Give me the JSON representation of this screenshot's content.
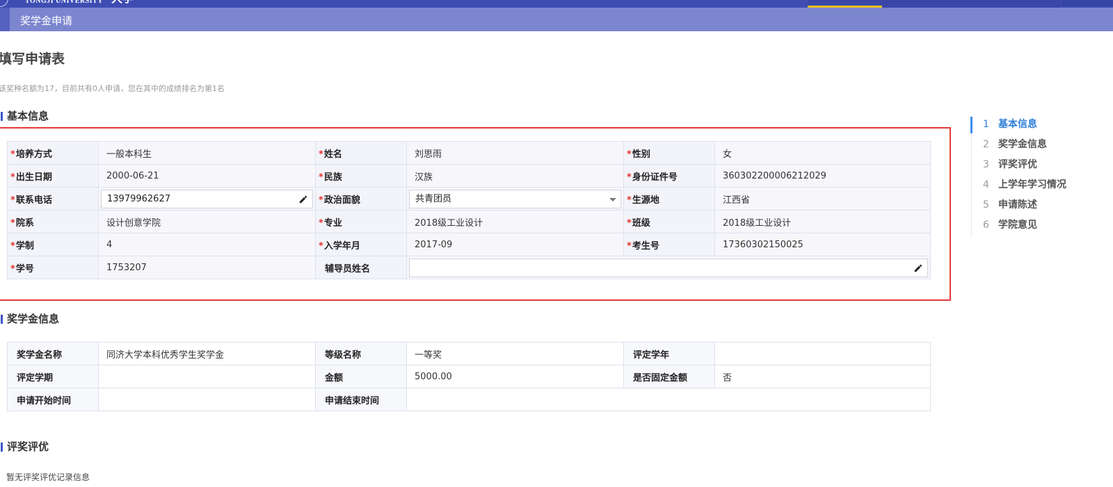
{
  "header": {
    "university_en": "TONGJI UNIVERSITY",
    "university_cn": "大学",
    "subbar_title": "奖学金申请"
  },
  "page": {
    "title": "填写申请表",
    "notice": "该奖种名额为17，目前共有0人申请，您在其中的成绩排名为第1名"
  },
  "sections": {
    "basic": "基本信息",
    "scholarship": "奖学金信息",
    "evaluation": "评奖评优"
  },
  "basic_info": {
    "rows": [
      [
        {
          "label": "培养方式",
          "value": "一般本科生",
          "required": true
        },
        {
          "label": "姓名",
          "value": "刘思雨",
          "required": true
        },
        {
          "label": "性别",
          "value": "女",
          "required": true
        }
      ],
      [
        {
          "label": "出生日期",
          "value": "2000-06-21",
          "required": true
        },
        {
          "label": "民族",
          "value": "汉族",
          "required": true
        },
        {
          "label": "身份证件号",
          "value": "360302200006212029",
          "required": true
        }
      ],
      [
        {
          "label": "联系电话",
          "value": "13979962627",
          "required": true,
          "input": "text"
        },
        {
          "label": "政治面貌",
          "value": "共青团员",
          "required": true,
          "input": "select"
        },
        {
          "label": "生源地",
          "value": "江西省",
          "required": true
        }
      ],
      [
        {
          "label": "院系",
          "value": "设计创意学院",
          "required": true
        },
        {
          "label": "专业",
          "value": "2018级工业设计",
          "required": true
        },
        {
          "label": "班级",
          "value": "2018级工业设计",
          "required": true
        }
      ],
      [
        {
          "label": "学制",
          "value": "4",
          "required": true
        },
        {
          "label": "入学年月",
          "value": "2017-09",
          "required": true
        },
        {
          "label": "考生号",
          "value": "17360302150025",
          "required": true
        }
      ],
      [
        {
          "label": "学号",
          "value": "1753207",
          "required": true
        },
        {
          "label": "辅导员姓名",
          "value": "",
          "required": false,
          "input": "text"
        }
      ]
    ]
  },
  "scholarship_info": {
    "rows": [
      [
        {
          "label": "奖学金名称",
          "value": "同济大学本科优秀学生奖学金"
        },
        {
          "label": "等级名称",
          "value": "一等奖"
        },
        {
          "label": "评定学年",
          "value": ""
        }
      ],
      [
        {
          "label": "评定学期",
          "value": ""
        },
        {
          "label": "金额",
          "value": "5000.00"
        },
        {
          "label": "是否固定金额",
          "value": "否"
        }
      ],
      [
        {
          "label": "申请开始时间",
          "value": ""
        },
        {
          "label": "申请结束时间",
          "value": ""
        }
      ]
    ]
  },
  "evaluation": {
    "empty_message": "暂无评奖评优记录信息"
  },
  "side_nav": {
    "items": [
      {
        "num": "1",
        "label": "基本信息",
        "active": true
      },
      {
        "num": "2",
        "label": "奖学金信息",
        "active": false
      },
      {
        "num": "3",
        "label": "评奖评优",
        "active": false
      },
      {
        "num": "4",
        "label": "上学年学习情况",
        "active": false
      },
      {
        "num": "5",
        "label": "申请陈述",
        "active": false
      },
      {
        "num": "6",
        "label": "学院意见",
        "active": false
      }
    ]
  },
  "icons": {
    "edit": "pencil-icon",
    "dropdown": "caret-down-icon"
  },
  "colors": {
    "header": "#3f4db3",
    "subbar": "#7c86cf",
    "required_star": "#e5322e",
    "highlight_border": "#e43a3a",
    "active_nav": "#2f7fd8",
    "active_tab_underline": "#f3c21c"
  }
}
